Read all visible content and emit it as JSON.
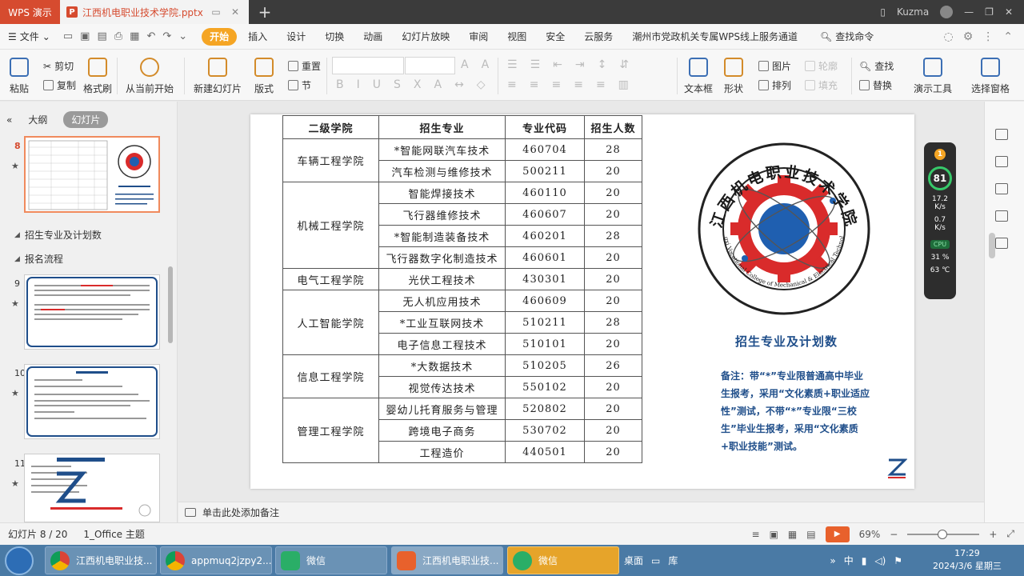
{
  "titlebar": {
    "app_tab": "WPS 演示",
    "doc_tab": "江西机电职业技术学院.pptx",
    "user": "Kuzma"
  },
  "menu": {
    "file": "文件",
    "items": [
      "开始",
      "插入",
      "设计",
      "切换",
      "动画",
      "幻灯片放映",
      "审阅",
      "视图",
      "安全",
      "云服务",
      "潮州市党政机关专属WPS线上服务通道"
    ],
    "search": "查找命令"
  },
  "ribbon": {
    "paste": "粘贴",
    "cut": "剪切",
    "copy": "复制",
    "format_painter": "格式刷",
    "from_current": "从当前开始",
    "new_slide": "新建幻灯片",
    "layout": "版式",
    "reset": "重置",
    "section": "节",
    "textbox": "文本框",
    "shape": "形状",
    "picture": "图片",
    "arrange": "排列",
    "fill": "填充",
    "outline": "轮廓",
    "find": "查找",
    "replace": "替换",
    "presenter_tools": "演示工具",
    "selection_pane": "选择窗格"
  },
  "left_panel": {
    "tab_outline": "大纲",
    "tab_slides": "幻灯片",
    "slides": [
      {
        "num": "8"
      },
      {
        "num": "9"
      },
      {
        "num": "10"
      },
      {
        "num": "11"
      }
    ],
    "sections": [
      "招生专业及计划数",
      "报名流程"
    ]
  },
  "table": {
    "headers": [
      "二级学院",
      "招生专业",
      "专业代码",
      "招生人数"
    ],
    "groups": [
      {
        "college": "车辆工程学院",
        "rows": [
          [
            "*智能网联汽车技术",
            "460704",
            "28"
          ],
          [
            "汽车检测与维修技术",
            "500211",
            "20"
          ]
        ]
      },
      {
        "college": "机械工程学院",
        "rows": [
          [
            "智能焊接技术",
            "460110",
            "20"
          ],
          [
            "飞行器维修技术",
            "460607",
            "20"
          ],
          [
            "*智能制造装备技术",
            "460201",
            "28"
          ],
          [
            "飞行器数字化制造技术",
            "460601",
            "20"
          ]
        ]
      },
      {
        "college": "电气工程学院",
        "rows": [
          [
            "光伏工程技术",
            "430301",
            "20"
          ]
        ]
      },
      {
        "college": "人工智能学院",
        "rows": [
          [
            "无人机应用技术",
            "460609",
            "20"
          ],
          [
            "*工业互联网技术",
            "510211",
            "28"
          ],
          [
            "电子信息工程技术",
            "510101",
            "20"
          ]
        ]
      },
      {
        "college": "信息工程学院",
        "rows": [
          [
            "*大数据技术",
            "510205",
            "26"
          ],
          [
            "视觉传达技术",
            "550102",
            "20"
          ]
        ]
      },
      {
        "college": "管理工程学院",
        "rows": [
          [
            "婴幼儿托育服务与管理",
            "520802",
            "20"
          ],
          [
            "跨境电子商务",
            "530702",
            "20"
          ],
          [
            "工程造价",
            "440501",
            "20"
          ]
        ]
      }
    ]
  },
  "slide": {
    "logo_cn": "江西机电职业技术学院",
    "logo_en": "Jiangxi Vocational College of Mechanical & Electrical Technology",
    "title": "招生专业及计划数",
    "note": "备注：带“*”专业限普通高中毕业生报考，采用“文化素质+职业适应性”测试，不带“*”专业限“三校生”毕业生报考，采用“文化素质+职业技能”测试。"
  },
  "widget": {
    "badge": "1",
    "percent": "81",
    "up_val": "17.2",
    "up_unit": "K/s",
    "down_val": "0.7",
    "down_unit": "K/s",
    "cpu_label": "CPU",
    "cpu_pct": "31 %",
    "cpu_temp": "63 ℃"
  },
  "notes": {
    "placeholder": "单击此处添加备注"
  },
  "status": {
    "slide_info": "幻灯片 8 / 20",
    "theme": "1_Office 主题",
    "zoom": "69%"
  },
  "taskbar": {
    "tasks": [
      "江西机电职业技...",
      "appmuq2jzpy2...",
      "微信",
      "江西机电职业技...",
      "微信"
    ],
    "desktop": "桌面",
    "library": "库",
    "time": "17:29",
    "date": "2024/3/6 星期三"
  },
  "colors": {
    "accent": "#f5a524",
    "wps_red": "#d64b2f",
    "note_blue": "#1f4e8a",
    "logo_red": "#d92b2b",
    "logo_blue": "#1f5fb0"
  }
}
